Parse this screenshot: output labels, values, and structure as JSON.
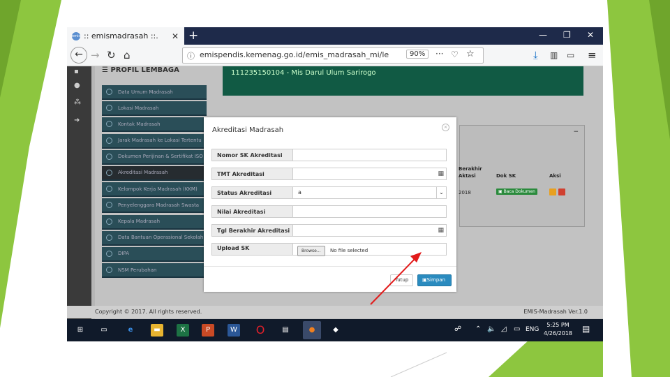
{
  "browser": {
    "tab_title": ":: emismadrasah ::.",
    "tab_favicon": "emis",
    "url": "emispendis.kemenag.go.id/emis_madrasah_mi/lembagacet",
    "zoom": "90%"
  },
  "page": {
    "menu_title": "☰ PROFIL LEMBAGA",
    "institution_header": "111235150104 - Mis Darul Ulum Sarirogo",
    "menu_items": [
      {
        "label": "Data Umum Madrasah"
      },
      {
        "label": "Lokasi Madrasah"
      },
      {
        "label": "Kontak Madrasah"
      },
      {
        "label": "Jarak Madrasah ke Lokasi Tertentu"
      },
      {
        "label": "Dokumen Perijinan & Sertifikat ISO"
      },
      {
        "label": "Akreditasi Madrasah"
      },
      {
        "label": "Kelompok Kerja Madrasah (KKM)"
      },
      {
        "label": "Penyelenggara Madrasah Swasta"
      },
      {
        "label": "Kepala Madrasah"
      },
      {
        "label": "Data Bantuan Operasional Sekolah"
      },
      {
        "label": "DIPA"
      },
      {
        "label": "NSM Perubahan"
      }
    ],
    "panel": {
      "col_berakhir": "Berakhir",
      "col_berakhir2": "Aktasi",
      "col_dok": "Dok SK",
      "col_aksi": "Aksi",
      "year": "2018",
      "doc_button": "Baca Dokumen"
    },
    "footer_left": "Copyright © 2017. All rights reserved.",
    "footer_right": "EMIS-Madrasah Ver.1.0"
  },
  "modal": {
    "title": "Akreditasi Madrasah",
    "fields": [
      {
        "label": "Nomor SK Akreditasi",
        "value": ""
      },
      {
        "label": "TMT Akreditasi",
        "value": ""
      },
      {
        "label": "Status Akreditasi",
        "value": "a"
      },
      {
        "label": "Nilai Akreditasi",
        "value": ""
      },
      {
        "label": "Tgl Berakhir Akreditasi",
        "value": ""
      },
      {
        "label": "Upload SK",
        "value": ""
      }
    ],
    "browse_label": "Browse...",
    "no_file": "No file selected",
    "btn_close": "Tutup",
    "btn_save": "Simpan"
  },
  "taskbar": {
    "language": "ENG",
    "time": "5:25 PM",
    "date": "4/26/2018"
  },
  "colors": {
    "slide_green": "#8dc63f",
    "modal_primary": "#2a8bbf",
    "header_green": "#115a44",
    "arrow_red": "#e21b1b"
  }
}
